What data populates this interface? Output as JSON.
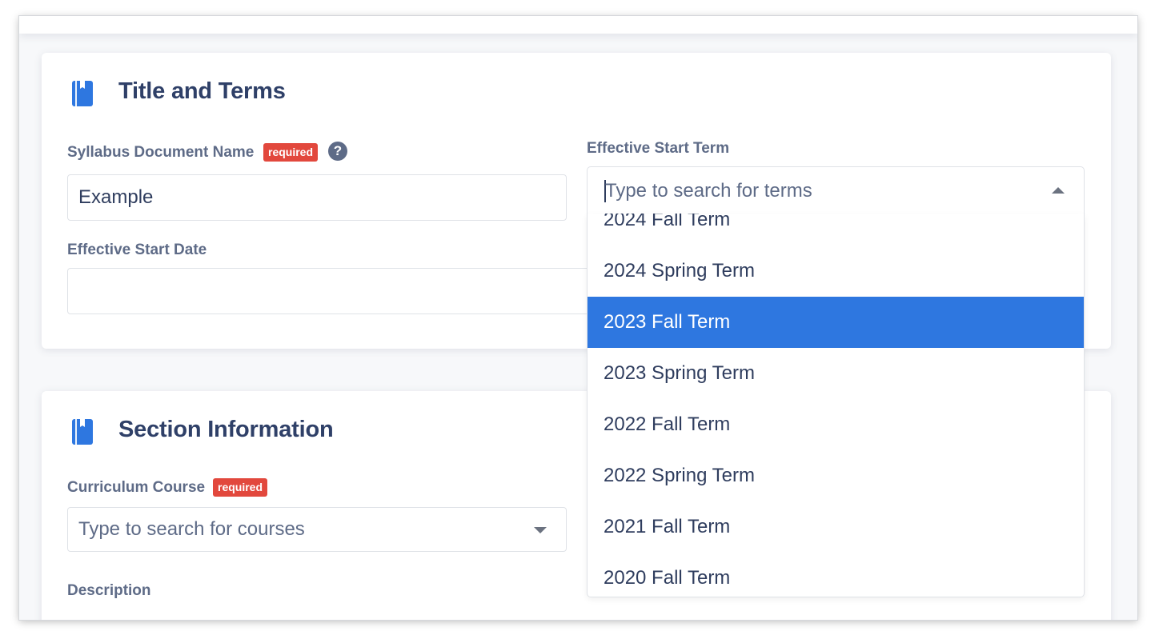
{
  "colors": {
    "accent": "#2e77e0",
    "required_badge": "#e2483d",
    "heading": "#2f4068",
    "label": "#5e6b87"
  },
  "title_card": {
    "icon": "book-icon",
    "heading": "Title and Terms",
    "doc_name": {
      "label": "Syllabus Document Name",
      "badge": "required",
      "help_icon": "question-circle-icon",
      "help_glyph": "?",
      "value": "Example"
    },
    "start_date": {
      "label": "Effective Start Date",
      "value": ""
    },
    "start_term": {
      "label": "Effective Start Term",
      "placeholder": "Type to search for terms",
      "options": [
        "2024 Fall Term",
        "2024 Spring Term",
        "2023 Fall Term",
        "2023 Spring Term",
        "2022 Fall Term",
        "2022 Spring Term",
        "2021 Fall Term",
        "2020 Fall Term"
      ],
      "highlighted": "2023 Fall Term"
    }
  },
  "section_card": {
    "icon": "book-icon",
    "heading": "Section Information",
    "course": {
      "label": "Curriculum Course",
      "badge": "required",
      "placeholder": "Type to search for courses"
    },
    "description": {
      "label": "Description"
    }
  }
}
